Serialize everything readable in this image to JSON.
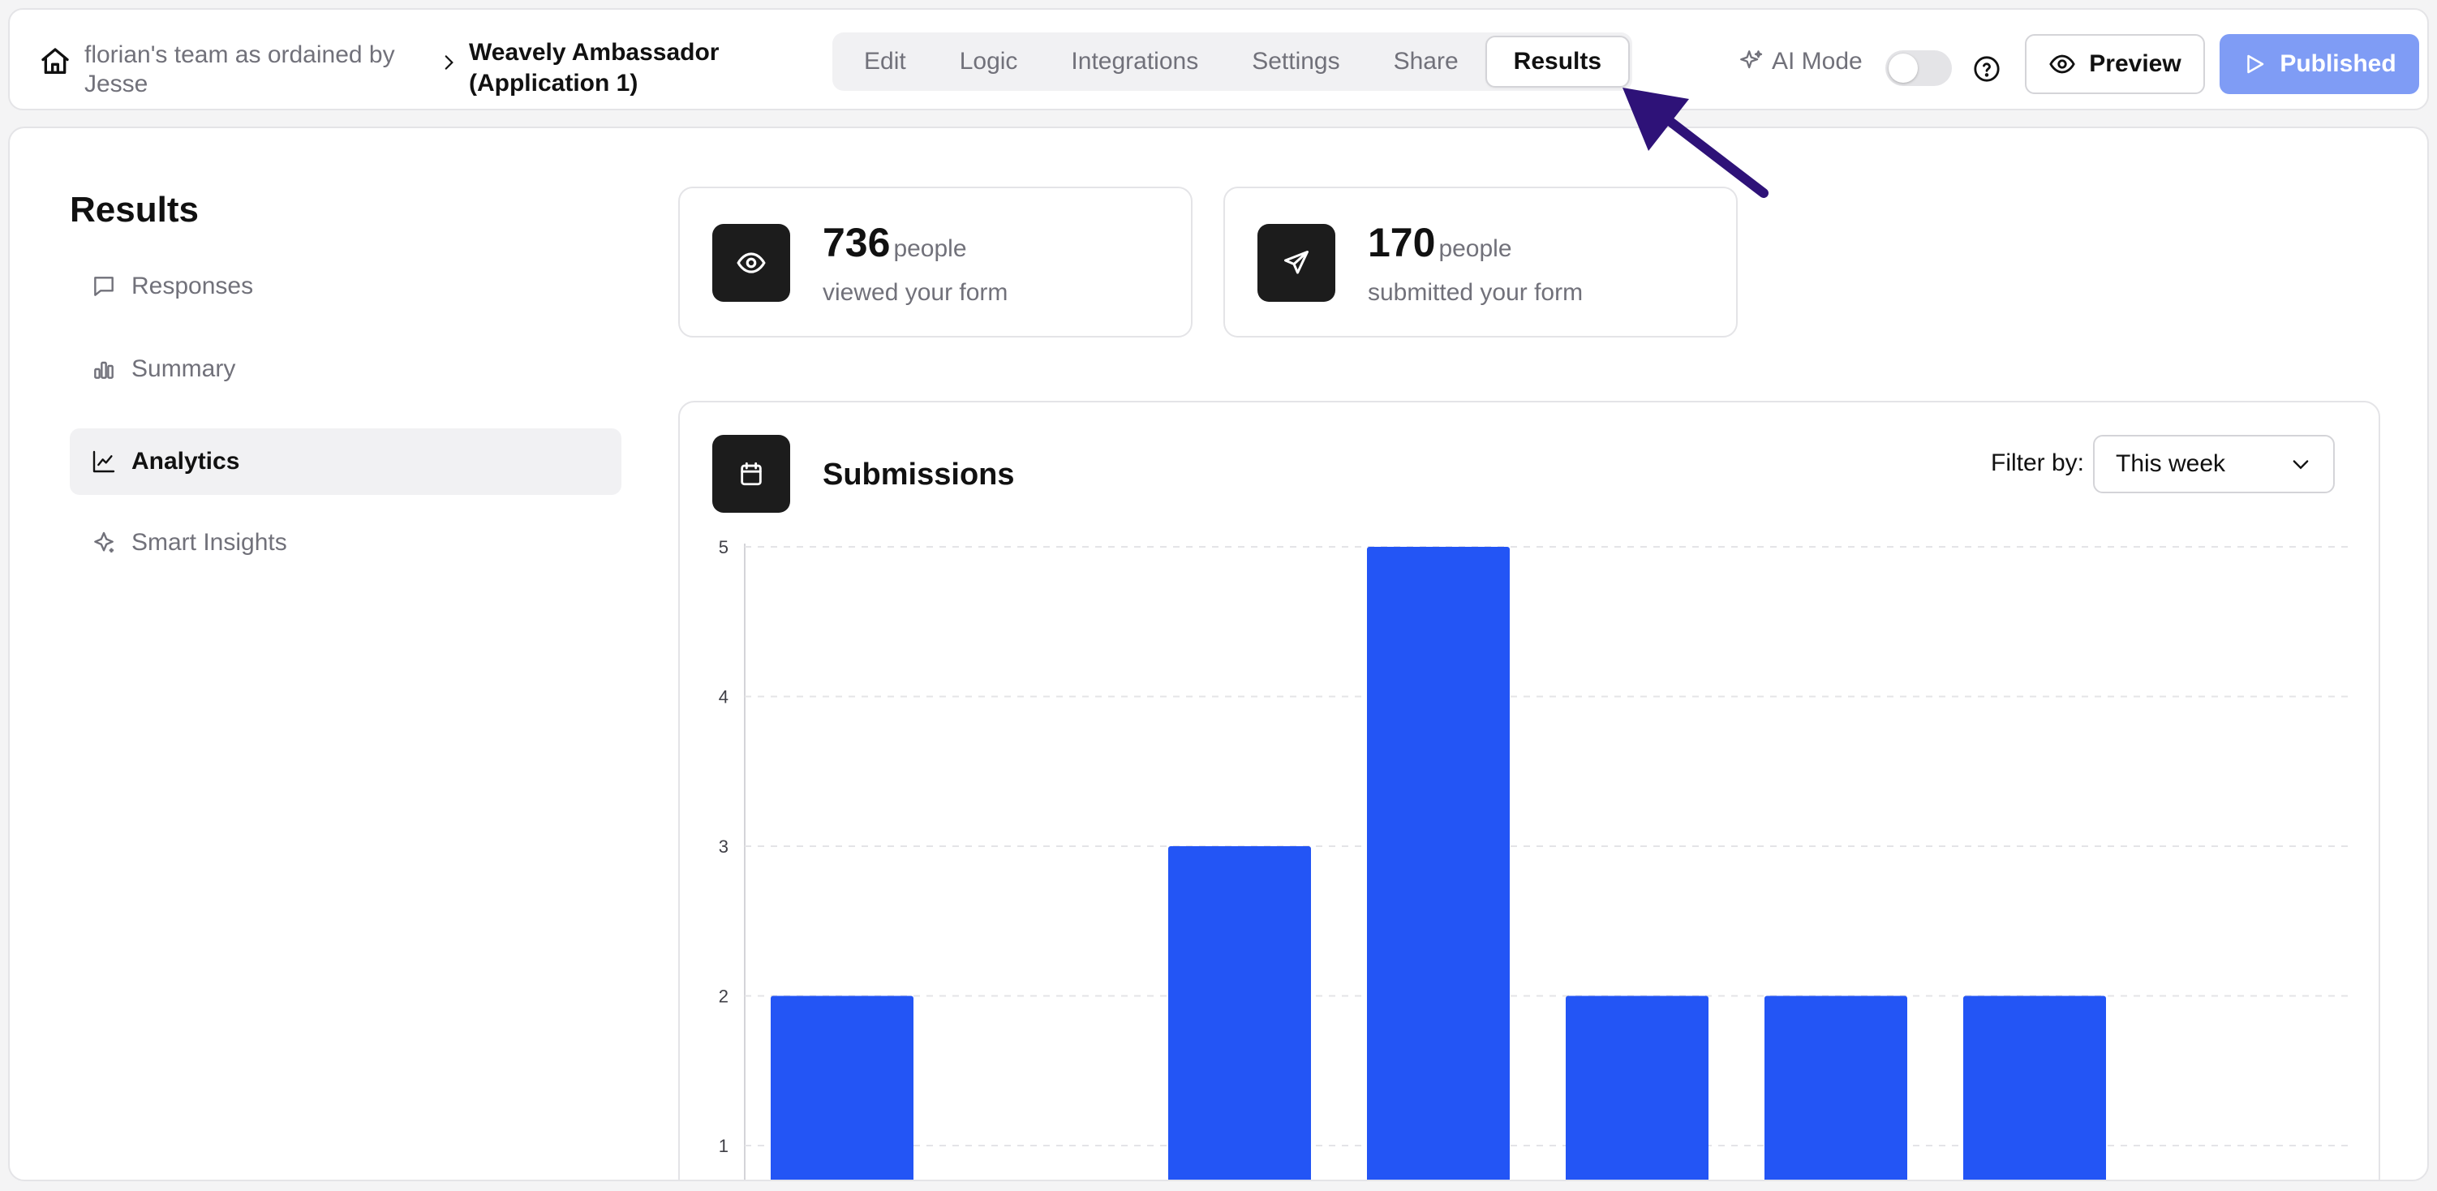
{
  "breadcrumb": {
    "team": "florian's team as ordained by Jesse",
    "form": "Weavely Ambassador (Application 1)"
  },
  "tabs": [
    {
      "label": "Edit",
      "active": false
    },
    {
      "label": "Logic",
      "active": false
    },
    {
      "label": "Integrations",
      "active": false
    },
    {
      "label": "Settings",
      "active": false
    },
    {
      "label": "Share",
      "active": false
    },
    {
      "label": "Results",
      "active": true
    }
  ],
  "toolbar": {
    "ai_mode_label": "AI Mode",
    "ai_mode_on": false,
    "preview_label": "Preview",
    "published_label": "Published"
  },
  "sidebar": {
    "title": "Results",
    "items": [
      {
        "label": "Responses",
        "icon": "message-icon",
        "active": false
      },
      {
        "label": "Summary",
        "icon": "bar-chart-icon",
        "active": false
      },
      {
        "label": "Analytics",
        "icon": "line-chart-icon",
        "active": true
      },
      {
        "label": "Smart Insights",
        "icon": "sparkle-icon",
        "active": false
      }
    ]
  },
  "stats": [
    {
      "value": "736",
      "unit": "people",
      "desc": "viewed your form",
      "icon": "eye-icon"
    },
    {
      "value": "170",
      "unit": "people",
      "desc": "submitted your form",
      "icon": "send-icon"
    }
  ],
  "submissions": {
    "title": "Submissions",
    "filter_label": "Filter by:",
    "filter_value": "This week"
  },
  "colors": {
    "accent": "#2355f5",
    "published": "#7f9cf5",
    "arrow": "#2e1278"
  },
  "chart_data": {
    "type": "bar",
    "categories": [
      "",
      "",
      "",
      "",
      "",
      "",
      "",
      ""
    ],
    "values": [
      2,
      0,
      3,
      5,
      2,
      2,
      2,
      0
    ],
    "yticks": [
      1,
      2,
      3,
      4,
      5
    ],
    "ylim": [
      0,
      5
    ],
    "grid": true
  }
}
